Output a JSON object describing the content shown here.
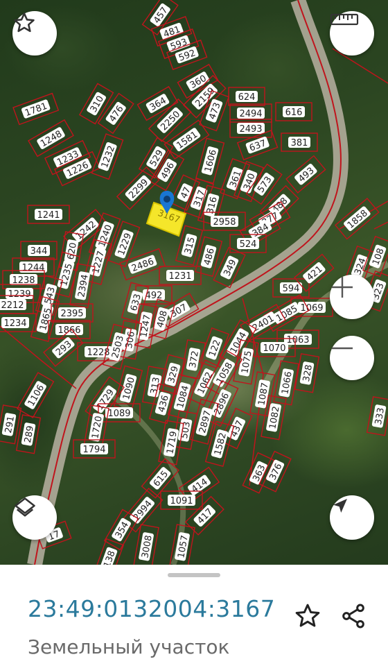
{
  "map": {
    "parcels": [
      {
        "label": "457"
      },
      {
        "label": "481"
      },
      {
        "label": "593"
      },
      {
        "label": "592"
      },
      {
        "label": "360"
      },
      {
        "label": "2159"
      },
      {
        "label": "473"
      },
      {
        "label": "624"
      },
      {
        "label": "2494"
      },
      {
        "label": "616"
      },
      {
        "label": "2493"
      },
      {
        "label": "637"
      },
      {
        "label": "381"
      },
      {
        "label": "493"
      },
      {
        "label": "1781"
      },
      {
        "label": "310"
      },
      {
        "label": "476"
      },
      {
        "label": "364"
      },
      {
        "label": "2250"
      },
      {
        "label": "1581"
      },
      {
        "label": "1248"
      },
      {
        "label": "1233"
      },
      {
        "label": "1226"
      },
      {
        "label": "1232"
      },
      {
        "label": "529"
      },
      {
        "label": "496"
      },
      {
        "label": "1606"
      },
      {
        "label": "361"
      },
      {
        "label": "340"
      },
      {
        "label": "573"
      },
      {
        "label": "2299"
      },
      {
        "label": "47"
      },
      {
        "label": "317"
      },
      {
        "label": "316"
      },
      {
        "label": "488"
      },
      {
        "label": "2958"
      },
      {
        "label": "377"
      },
      {
        "label": "1858"
      },
      {
        "label": "384"
      },
      {
        "label": "524"
      },
      {
        "label": "1241"
      },
      {
        "label": "1242"
      },
      {
        "label": "1240"
      },
      {
        "label": "1229"
      },
      {
        "label": "315"
      },
      {
        "label": "486"
      },
      {
        "label": "349"
      },
      {
        "label": "344"
      },
      {
        "label": "620"
      },
      {
        "label": "1227"
      },
      {
        "label": "2486"
      },
      {
        "label": "1244"
      },
      {
        "label": "1235"
      },
      {
        "label": "1231"
      },
      {
        "label": "1238"
      },
      {
        "label": "1239"
      },
      {
        "label": "543"
      },
      {
        "label": "2394"
      },
      {
        "label": "492"
      },
      {
        "label": "594"
      },
      {
        "label": "421"
      },
      {
        "label": "324"
      },
      {
        "label": "108"
      },
      {
        "label": "323"
      },
      {
        "label": "2212"
      },
      {
        "label": "633"
      },
      {
        "label": "307"
      },
      {
        "label": "1069"
      },
      {
        "label": "1865"
      },
      {
        "label": "2395"
      },
      {
        "label": "408"
      },
      {
        "label": "1085"
      },
      {
        "label": "1234"
      },
      {
        "label": "1247"
      },
      {
        "label": "2401"
      },
      {
        "label": "1866"
      },
      {
        "label": "306"
      },
      {
        "label": "122"
      },
      {
        "label": "1044"
      },
      {
        "label": "1063"
      },
      {
        "label": "1070"
      },
      {
        "label": "293"
      },
      {
        "label": "1228"
      },
      {
        "label": "2503"
      },
      {
        "label": "372"
      },
      {
        "label": "1075"
      },
      {
        "label": "328"
      },
      {
        "label": "313"
      },
      {
        "label": "329"
      },
      {
        "label": "1062"
      },
      {
        "label": "1058"
      },
      {
        "label": "1066"
      },
      {
        "label": "1106"
      },
      {
        "label": "1090"
      },
      {
        "label": "436"
      },
      {
        "label": "1084"
      },
      {
        "label": "2896"
      },
      {
        "label": "1087"
      },
      {
        "label": "1729"
      },
      {
        "label": "1089"
      },
      {
        "label": "2897"
      },
      {
        "label": "1082"
      },
      {
        "label": "333"
      },
      {
        "label": "291"
      },
      {
        "label": "289"
      },
      {
        "label": "1720"
      },
      {
        "label": "503"
      },
      {
        "label": "437"
      },
      {
        "label": "1719"
      },
      {
        "label": "1582"
      },
      {
        "label": "1794"
      },
      {
        "label": "363"
      },
      {
        "label": "376"
      },
      {
        "label": "615"
      },
      {
        "label": "414"
      },
      {
        "label": "1091"
      },
      {
        "label": "2994"
      },
      {
        "label": "417"
      },
      {
        "label": "354"
      },
      {
        "label": "3008"
      },
      {
        "label": "1057"
      },
      {
        "label": "138"
      },
      {
        "label": "17"
      }
    ],
    "selected_parcel": {
      "label": "3167"
    }
  },
  "buttons": {
    "favorite_icon": "star-outline-icon",
    "ruler_icon": "ruler-icon",
    "zoom_in_icon": "plus-icon",
    "zoom_out_icon": "minus-icon",
    "layers_icon": "layers-icon",
    "locate_icon": "navigation-arrow-icon"
  },
  "sheet": {
    "cadastral_number": "23:49:0132004:3167",
    "object_type": "Земельный участок",
    "favorite_icon": "star-outline-icon",
    "share_icon": "share-icon"
  },
  "colors": {
    "parcel_border": "#c0141c",
    "selected_fill": "#f5e62a",
    "pin": "#1976d2",
    "cadastral_text": "#2b7a9c",
    "road": "#b9b2a2"
  }
}
